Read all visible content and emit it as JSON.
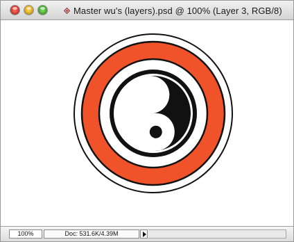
{
  "window": {
    "title": "Master wu's (layers).psd @ 100% (Layer 3, RGB/8)",
    "buttons": {
      "close": "close-icon",
      "minimize": "minimize-icon",
      "zoom": "zoom-icon"
    },
    "proxy_icon": "document-proxy-icon"
  },
  "canvas": {
    "artwork": "yin-yang-emblem",
    "colors": {
      "ring": "#f0532a",
      "outline": "#111111",
      "background": "#ffffff"
    }
  },
  "status_bar": {
    "zoom": "100%",
    "doc_info": "Doc: 531.6K/4.39M",
    "menu_arrow": "triangle-right-icon"
  }
}
